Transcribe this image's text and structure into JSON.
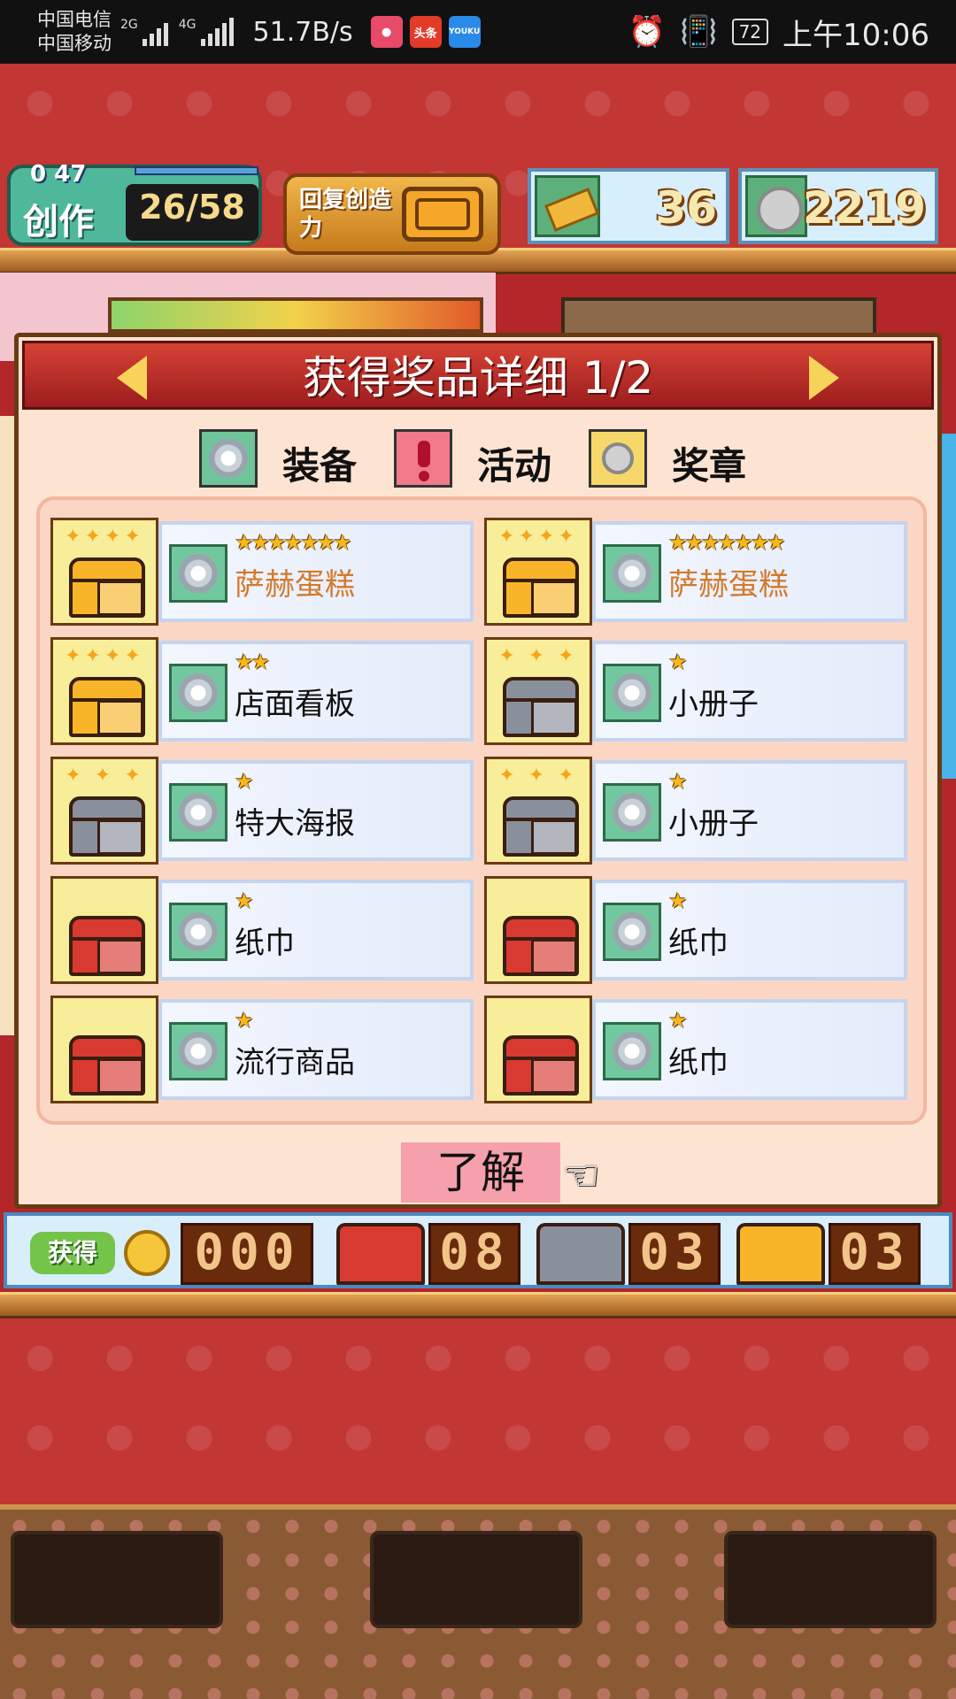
{
  "status_bar": {
    "carrier1": "中国电信",
    "carrier2": "中国移动",
    "net1": "2G",
    "net2": "4G",
    "speed": "51.7B/s",
    "battery": "72",
    "time": "上午10:06",
    "app_icons": [
      "messenger-icon",
      "toutiao-icon",
      "youku-icon"
    ],
    "app_icon_labels": [
      "",
      "头条",
      "YOUKU"
    ]
  },
  "hud": {
    "create_label": "创作",
    "create_counter": "0 47",
    "energy": "26/58",
    "restore_label": "回复创造力",
    "tickets": "36",
    "coins": "2219"
  },
  "dialog": {
    "title": "获得奖品详细 1/2",
    "legend": {
      "equip": "装备",
      "event": "活动",
      "medal": "奖章"
    },
    "items": [
      {
        "chest": "gold",
        "stars": "★★★★★★★",
        "name": "萨赫蛋糕",
        "highlight": true
      },
      {
        "chest": "gold",
        "stars": "★★★★★★★",
        "name": "萨赫蛋糕",
        "highlight": true
      },
      {
        "chest": "gold",
        "stars": "★★",
        "name": "店面看板",
        "highlight": false
      },
      {
        "chest": "silver",
        "stars": "★",
        "name": "小册子",
        "highlight": false
      },
      {
        "chest": "silver",
        "stars": "★",
        "name": "特大海报",
        "highlight": false
      },
      {
        "chest": "silver",
        "stars": "★",
        "name": "小册子",
        "highlight": false
      },
      {
        "chest": "red",
        "stars": "★",
        "name": "纸巾",
        "highlight": false
      },
      {
        "chest": "red",
        "stars": "★",
        "name": "纸巾",
        "highlight": false
      },
      {
        "chest": "red",
        "stars": "★",
        "name": "流行商品",
        "highlight": false
      },
      {
        "chest": "red",
        "stars": "★",
        "name": "纸巾",
        "highlight": false
      }
    ],
    "ok_label": "了解"
  },
  "totals": {
    "got_label": "获得",
    "coins": "000",
    "red_count": "08",
    "silver_count": "03",
    "gold_count": "03"
  },
  "colors": {
    "header_red": "#b3262a",
    "gold_text": "#d4792a",
    "star": "#f6b81a"
  }
}
